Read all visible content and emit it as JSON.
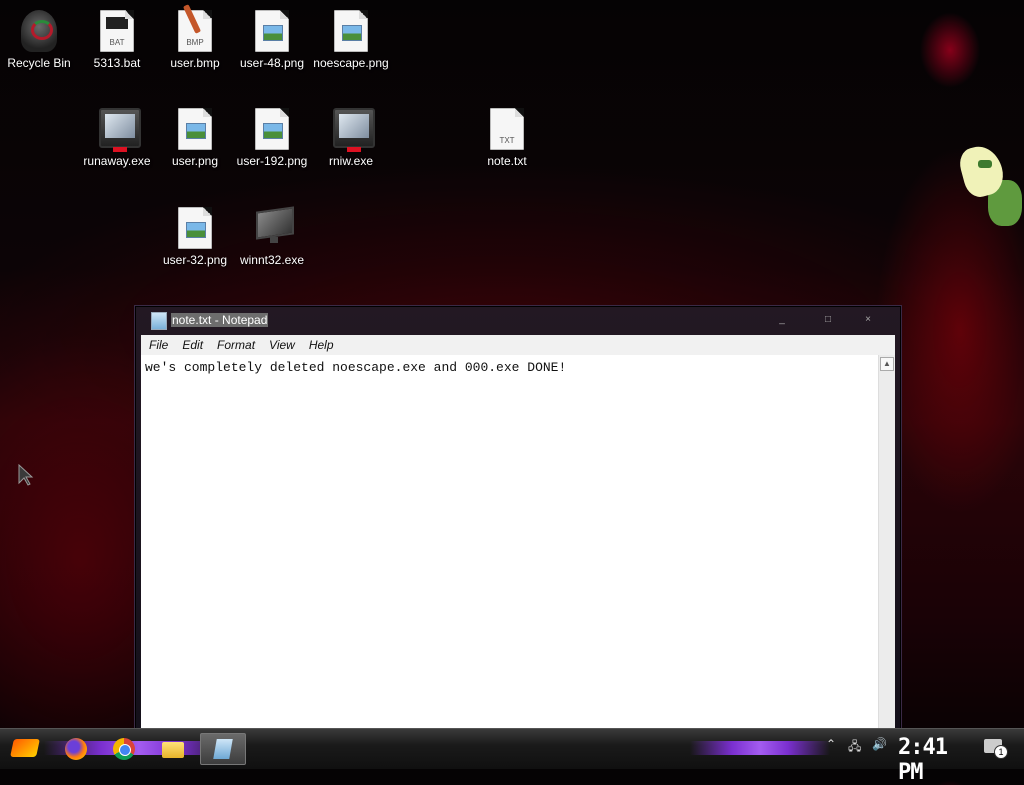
{
  "desktop": {
    "icons": [
      {
        "label": "Recycle Bin"
      },
      {
        "label": "5313.bat",
        "tag": "BAT"
      },
      {
        "label": "user.bmp",
        "tag": "BMP"
      },
      {
        "label": "user-48.png"
      },
      {
        "label": "noescape.png"
      },
      {
        "label": "runaway.exe"
      },
      {
        "label": "user.png"
      },
      {
        "label": "user-192.png"
      },
      {
        "label": "rniw.exe"
      },
      {
        "label": "note.txt",
        "tag": "TXT"
      },
      {
        "label": "user-32.png"
      },
      {
        "label": "winnt32.exe"
      }
    ]
  },
  "notepad": {
    "title": "note.txt - Notepad",
    "menu": [
      "File",
      "Edit",
      "Format",
      "View",
      "Help"
    ],
    "content": "we's completely deleted noescape.exe and 000.exe DONE!",
    "controls": {
      "minimize": "_",
      "maximize": "□",
      "close": "×"
    }
  },
  "taskbar": {
    "clock": "2:41 PM",
    "notification_count": "1",
    "apps": [
      "start-icon",
      "firefox-icon",
      "chrome-icon",
      "file-explorer-icon",
      "notepad-icon"
    ]
  },
  "colors": {
    "accent_purple": "#7a2fcf",
    "desktop_red": "#2a0408",
    "title_highlight": "#6d6d6d"
  }
}
